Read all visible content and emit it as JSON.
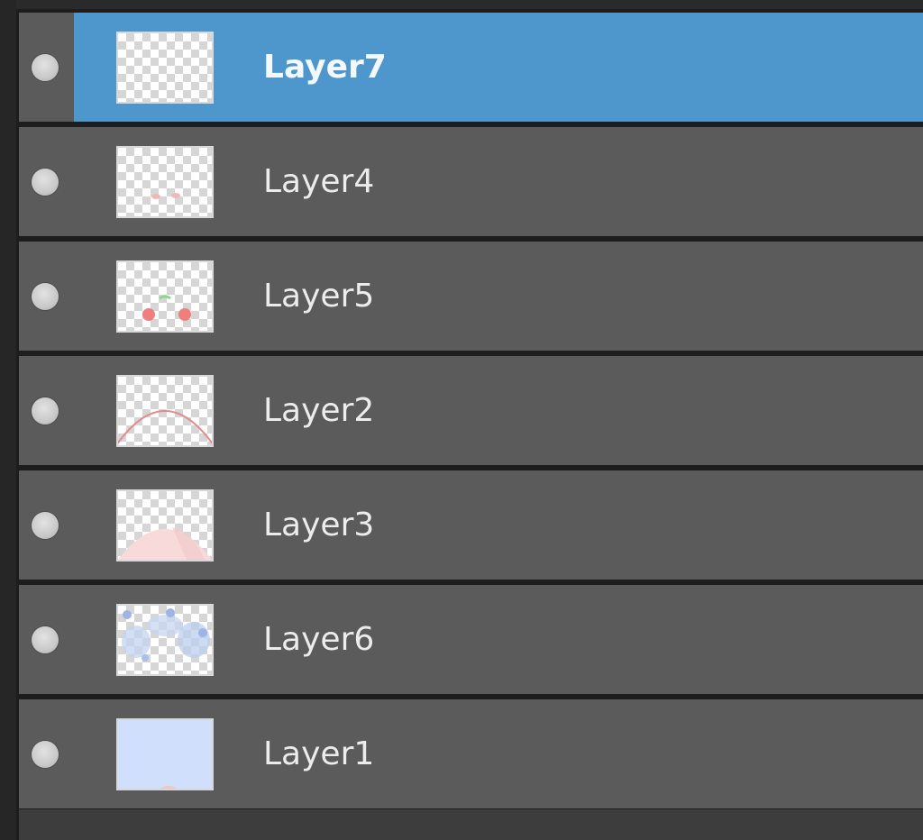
{
  "layers_panel": {
    "layers": [
      {
        "name": "Layer7",
        "selected": true,
        "thumbnail": "empty-transparent"
      },
      {
        "name": "Layer4",
        "selected": false,
        "thumbnail": "pink-dots"
      },
      {
        "name": "Layer5",
        "selected": false,
        "thumbnail": "red-dots-green-mark"
      },
      {
        "name": "Layer2",
        "selected": false,
        "thumbnail": "red-arc"
      },
      {
        "name": "Layer3",
        "selected": false,
        "thumbnail": "pink-dome"
      },
      {
        "name": "Layer6",
        "selected": false,
        "thumbnail": "blue-cloud-strokes"
      },
      {
        "name": "Layer1",
        "selected": false,
        "thumbnail": "light-blue-fill"
      }
    ],
    "colors": {
      "row_background": "#5b5b5b",
      "selected_background": "#4e97cd",
      "panel_background": "#1d1d1d",
      "text": "#ececec"
    },
    "icons": {
      "visibility": "visibility-dot-icon"
    }
  }
}
